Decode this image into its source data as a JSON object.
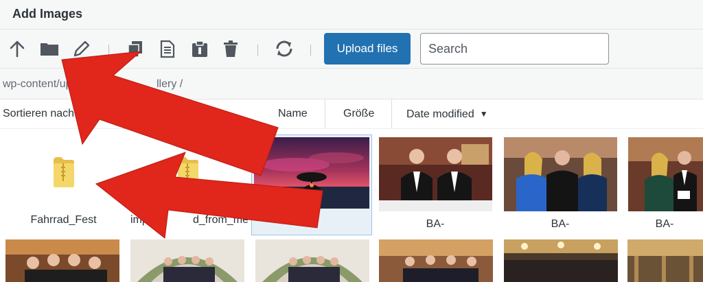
{
  "window": {
    "title": "Add Images"
  },
  "toolbar": {
    "icons": [
      "arrow-up-icon",
      "folder-icon",
      "pencil-icon",
      "copy-icon",
      "document-icon",
      "paste-icon",
      "trash-icon",
      "refresh-icon"
    ],
    "upload_label": "Upload files",
    "search_placeholder": "Search"
  },
  "breadcrumb": {
    "path_start": "wp-content/uplo",
    "path_end": "llery /"
  },
  "sort": {
    "label": "Sortieren nach:",
    "columns": [
      "Name",
      "Größe",
      "Date modified"
    ],
    "active_column": "Date modified",
    "direction": "descending"
  },
  "files": {
    "row1": [
      {
        "type": "folder",
        "name": "Fahrrad_Fest"
      },
      {
        "type": "folder",
        "name": "imp",
        "name_end": "d_from_medi"
      },
      {
        "type": "image",
        "name": "e-",
        "selected": true
      },
      {
        "type": "image",
        "name": "BA-"
      },
      {
        "type": "image",
        "name": "BA-"
      },
      {
        "type": "image",
        "name": "BA-"
      }
    ]
  },
  "colors": {
    "accent": "#2271b1",
    "arrow": "#e1261c",
    "folder": "#f1d264",
    "selection": "#e8f0f7"
  }
}
